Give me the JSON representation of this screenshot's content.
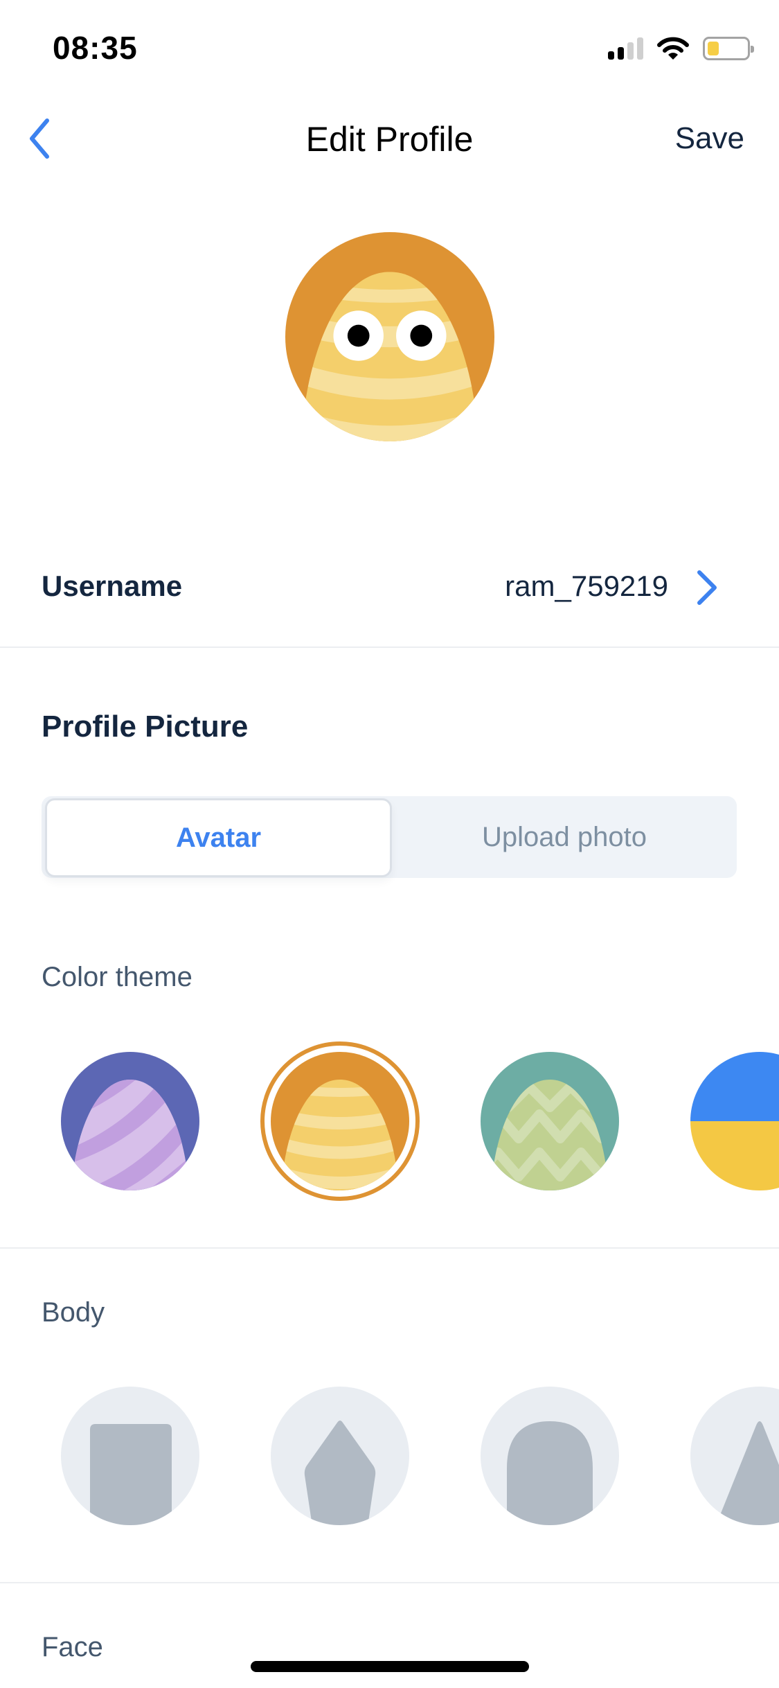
{
  "status_bar": {
    "time": "08:35",
    "signal_bars_active": 2,
    "signal_bars_total": 4,
    "battery_level_percent": 20,
    "battery_color": "#f6ce46",
    "wifi_icon": "wifi-icon"
  },
  "nav": {
    "title": "Edit Profile",
    "back_icon": "chevron-left-icon",
    "save_label": "Save"
  },
  "profile": {
    "avatar_theme": "orange",
    "username_label": "Username",
    "username_value": "ram_759219"
  },
  "profile_picture": {
    "title": "Profile Picture",
    "tabs": [
      {
        "label": "Avatar",
        "selected": true
      },
      {
        "label": "Upload photo",
        "selected": false
      }
    ]
  },
  "color_theme": {
    "label": "Color theme",
    "selected_index": 1,
    "options": [
      {
        "name": "purple",
        "pattern": "diagonal-stripes",
        "bg": "#5c67b4",
        "egg": "#d7bfea",
        "stripe": "#c19fdf"
      },
      {
        "name": "orange",
        "pattern": "horizontal-stripes",
        "bg": "#de9333",
        "egg": "#f4cf6b",
        "stripe": "#f7e09c"
      },
      {
        "name": "teal",
        "pattern": "zigzag",
        "bg": "#6dada4",
        "egg": "#c0d191",
        "stripe": "#d1deb0"
      },
      {
        "name": "blue-yellow",
        "pattern": "split",
        "bg": "#3d88f2",
        "egg": "#f4c844",
        "stripe": ""
      }
    ]
  },
  "body": {
    "label": "Body",
    "options": [
      {
        "name": "square"
      },
      {
        "name": "pentagon"
      },
      {
        "name": "arch"
      },
      {
        "name": "triangle"
      }
    ]
  },
  "face": {
    "label": "Face"
  },
  "colors": {
    "accent": "#3d82ef",
    "text_primary": "#14263f",
    "text_secondary": "#44576d",
    "text_muted": "#7d8fa1",
    "body_shape": "#b1bac4",
    "body_bg": "#e9edf2"
  }
}
